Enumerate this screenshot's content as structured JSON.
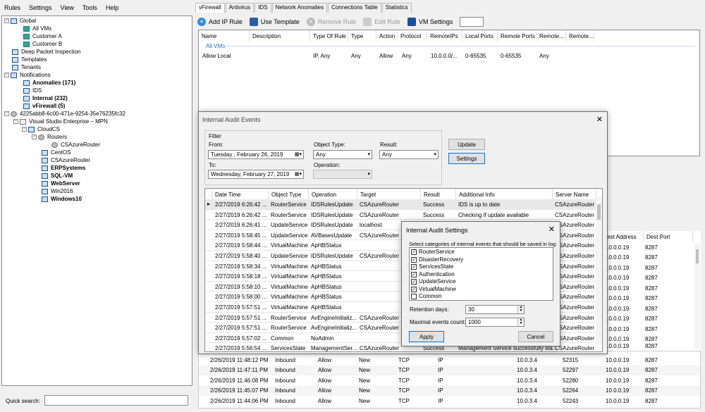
{
  "menu": [
    "Rules",
    "Settings",
    "View",
    "Tools",
    "Help"
  ],
  "tree": {
    "global": "Global",
    "all_vms": "All VMs",
    "customer_a": "Customer A",
    "customer_b": "Customer B",
    "dpi": "Deep Packet Inspection",
    "templates": "Templates",
    "tenants": "Tenants",
    "notifications": "Notifications",
    "anomalies": "Anomalies (171)",
    "ids": "IDS",
    "internal": "Internal (232)",
    "vfirewall": "vFirewall (5)",
    "host": "4225abb8-6c00-471e-9254-35e76235fc32",
    "subscription": "Visual Studio Enterprise – MPN",
    "cloudcs": "CloudCS",
    "routers": "Routers",
    "csazurerouter_sub": "CSAzureRouter",
    "vms": [
      "CentOS",
      "CSAzureRouter",
      "ERPSystems",
      "SQL-VM",
      "WebServer",
      "Win2016",
      "Windows10"
    ]
  },
  "quick_search_label": "Quick search:",
  "tabs": [
    "vFirewall",
    "Antivirus",
    "IDS",
    "Network Anomalies",
    "Connections Table",
    "Statistics"
  ],
  "toolbar": {
    "add_ip_rule": "Add IP Rule",
    "use_template": "Use Template",
    "remove_rule": "Remove Rule",
    "edit_rule": "Edit Rule",
    "vm_settings": "VM Settings"
  },
  "rules": {
    "columns": [
      "Name",
      "Description",
      "Type Of Rule",
      "Type",
      "Action",
      "Protocol",
      "RemoteIPs",
      "Local Ports",
      "Remote Ports",
      "Remote...",
      "Remote..."
    ],
    "group": "All VMs",
    "row": [
      "Allow Local",
      "",
      "IP, Any",
      "Any",
      "Allow",
      "Any",
      "10.0.0.0/...",
      "0-65535",
      "0-65535",
      "Any",
      ""
    ]
  },
  "right_grid": {
    "columns": [
      "est Address",
      "Dest Port"
    ],
    "rows": [
      [
        "10.0.0.19",
        "8287"
      ],
      [
        "10.0.0.19",
        "8287"
      ],
      [
        "10.0.0.19",
        "8287"
      ],
      [
        "10.0.0.19",
        "8287"
      ],
      [
        "10.0.0.19",
        "8287"
      ],
      [
        "10.0.0.19",
        "8287"
      ],
      [
        "10.0.0.19",
        "8287"
      ],
      [
        "10.0.0.19",
        "8287"
      ],
      [
        "10.0.0.19",
        "8287"
      ],
      [
        "10.0.0.19",
        "8287"
      ],
      [
        "10.0.0.19",
        "8287"
      ]
    ]
  },
  "bottom_rows": [
    [
      "2/26/2019 11:48:12 PM",
      "Inbound",
      "Allow",
      "New",
      "TCP",
      "IP",
      "10.0.3.4",
      "52315",
      "10.0.0.19",
      "8287"
    ],
    [
      "2/26/2019 11:47:11 PM",
      "Inbound",
      "Allow",
      "New",
      "TCP",
      "IP",
      "10.0.3.4",
      "52297",
      "10.0.0.19",
      "8287"
    ],
    [
      "2/26/2019 11:46:08 PM",
      "Inbound",
      "Allow",
      "New",
      "TCP",
      "IP",
      "10.0.3.4",
      "52280",
      "10.0.0.19",
      "8287"
    ],
    [
      "2/26/2019 11:45:07 PM",
      "Inbound",
      "Allow",
      "New",
      "TCP",
      "IP",
      "10.0.3.4",
      "52264",
      "10.0.0.19",
      "8287"
    ],
    [
      "2/26/2019 11:44:06 PM",
      "Inbound",
      "Allow",
      "New",
      "TCP",
      "IP",
      "10.0.3.4",
      "52243",
      "10.0.0.19",
      "8287"
    ]
  ],
  "audit": {
    "title": "Internal Audit Events",
    "filter": "Filter",
    "from_label": "From:",
    "from_value": "Tuesday   ,  February  26, 2019",
    "to_label": "To:",
    "to_value": "Wednesday,  February  27, 2019",
    "object_type_label": "Object Type:",
    "object_type_value": "Any",
    "operation_label": "Operation:",
    "result_label": "Result:",
    "result_value": "Any",
    "update_btn": "Update",
    "settings_btn": "Settings",
    "columns": [
      "Date Time",
      "Object Type",
      "Operation",
      "Target",
      "Result",
      "Additional Info",
      "Server Name"
    ],
    "rows": [
      [
        "2/27/2019 6:26:42 ...",
        "RouterService",
        "IDSRulesUpdate",
        "CSAzureRouter",
        "Success",
        "IDS is up to date",
        "CSAzureRouter"
      ],
      [
        "2/27/2019 6:26:42 ...",
        "RouterService",
        "IDSRulesUpdate",
        "CSAzureRouter",
        "Success",
        "Checking if update available",
        "CSAzureRouter"
      ],
      [
        "2/27/2019 6:26:41 ...",
        "UpdateService",
        "IDSRulesUpdate",
        "localhost",
        "",
        "",
        "CSAzureRouter"
      ],
      [
        "2/27/2019 5:58:45 ...",
        "UpdateService",
        "AVBasesUpdate",
        "CSAzureRouter",
        "",
        "",
        "CSAzureRouter"
      ],
      [
        "2/27/2019 5:58:44 ...",
        "VirtualMachine",
        "ApHBStatus",
        "",
        "",
        "",
        "CSAzureRouter"
      ],
      [
        "2/27/2019 5:58:40 ...",
        "UpdateService",
        "IDSRulesUpdate",
        "CSAzureRouter",
        "",
        "",
        "CSAzureRouter"
      ],
      [
        "2/27/2019 5:58:34 ...",
        "VirtualMachine",
        "ApHBStatus",
        "",
        "",
        "",
        "CSAzureRouter"
      ],
      [
        "2/27/2019 5:58:18 ...",
        "VirtualMachine",
        "ApHBStatus",
        "",
        "",
        "",
        "CSAzureRouter"
      ],
      [
        "2/27/2019 5:58:10 ...",
        "VirtualMachine",
        "ApHBStatus",
        "",
        "",
        "",
        "CSAzureRouter"
      ],
      [
        "2/27/2019 5:58:00 ...",
        "VirtualMachine",
        "ApHBStatus",
        "",
        "",
        "",
        "CSAzureRouter"
      ],
      [
        "2/27/2019 5:57:51 ...",
        "VirtualMachine",
        "ApHBStatus",
        "",
        "",
        "",
        "CSAzureRouter"
      ],
      [
        "2/27/2019 5:57:51 ...",
        "RouterService",
        "AvEngineInitializ...",
        "CSAzureRouter",
        "",
        "",
        "CSAzureRouter"
      ],
      [
        "2/27/2019 5:57:51 ...",
        "RouterService",
        "AvEngineInitializ...",
        "CSAzureRouter",
        "",
        "",
        "CSAzureRouter"
      ],
      [
        "2/27/2019 5:57:02 ...",
        "Common",
        "NoAdmin",
        "",
        "",
        "",
        "CSAzureRouter"
      ],
      [
        "2/27/2019 5:56:54 ...",
        "ServicesState",
        "ManagementSer...",
        "CSAzureRouter",
        "Success",
        "Management Service successfully sta...",
        "CSAzureRouter"
      ]
    ]
  },
  "settings_dialog": {
    "title": "Internal Audit Settings",
    "prompt": "Select categories of internal events that should be saved in log:",
    "categories": [
      {
        "label": "RouterService",
        "checked": true
      },
      {
        "label": "DisasterRecovery",
        "checked": true
      },
      {
        "label": "ServicesState",
        "checked": true
      },
      {
        "label": "Authentication",
        "checked": true
      },
      {
        "label": "UpdateService",
        "checked": true
      },
      {
        "label": "VirtualMachine",
        "checked": true
      },
      {
        "label": "Common",
        "checked": false
      }
    ],
    "retention_label": "Retention days:",
    "retention_value": "30",
    "max_label": "Maximal events count:",
    "max_value": "1000",
    "apply": "Apply",
    "cancel": "Cancel"
  }
}
